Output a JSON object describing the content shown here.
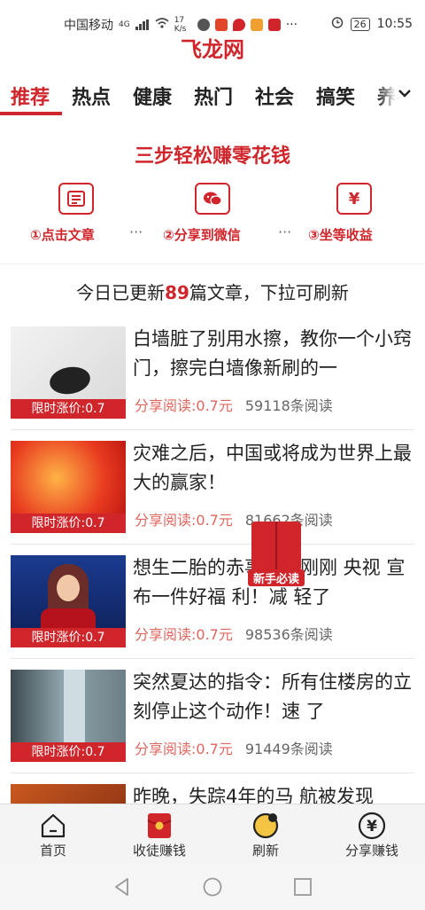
{
  "status_bar": {
    "carrier": "中国移动",
    "network": "4G",
    "speed": "17 K/s",
    "battery": "26",
    "time": "10:55"
  },
  "app": {
    "title": "飞龙网"
  },
  "tabs": [
    {
      "label": "推荐",
      "active": true
    },
    {
      "label": "热点"
    },
    {
      "label": "健康"
    },
    {
      "label": "热门"
    },
    {
      "label": "社会"
    },
    {
      "label": "搞笑"
    },
    {
      "label": "养"
    }
  ],
  "promo": {
    "title": "三步轻松赚零花钱",
    "steps": [
      {
        "label": "①点击文章",
        "icon": "article-icon"
      },
      {
        "label": "②分享到微信",
        "icon": "wechat-icon"
      },
      {
        "label": "③坐等收益",
        "icon": "yuan-icon"
      }
    ],
    "separator": "···"
  },
  "update": {
    "prefix": "今日已更新",
    "count": "89",
    "suffix": "篇文章，下拉可刷新"
  },
  "news": [
    {
      "title": "白墙脏了别用水擦，教你一个小窍门，擦完白墙像新刷的一",
      "badge": "限时涨价:0.7",
      "share": "分享阅读:0.7元",
      "reads": "59118条阅读"
    },
    {
      "title": "灾难之后，中国或将成为世界上最大的赢家！",
      "badge": "限时涨价:0.7",
      "share": "分享阅读:0.7元",
      "reads": "81662条阅读"
    },
    {
      "title": "想生二胎的赤事了，刚刚 央视 宣布一件好福 利！减 轻了",
      "badge": "限时涨价:0.7",
      "share": "分享阅读:0.7元",
      "reads": "98536条阅读"
    },
    {
      "title": "突然夏达的指令：所有住楼房的立刻停止这个动作！速 了",
      "badge": "限时涨价:0.7",
      "share": "分享阅读:0.7元",
      "reads": "91449条阅读"
    },
    {
      "title": "昨晚，失踪4年的马 航被发现",
      "badge": "",
      "share": "",
      "reads": ""
    }
  ],
  "float_badge": {
    "label": "新手必读"
  },
  "bottom_nav": [
    {
      "label": "首页",
      "icon": "home-icon"
    },
    {
      "label": "收徒赚钱",
      "icon": "red-envelope-icon"
    },
    {
      "label": "刷新",
      "icon": "refresh-icon"
    },
    {
      "label": "分享赚钱",
      "icon": "yuan-circle-icon"
    }
  ],
  "colors": {
    "brand": "#d0252b",
    "share_text": "#e0665e"
  }
}
